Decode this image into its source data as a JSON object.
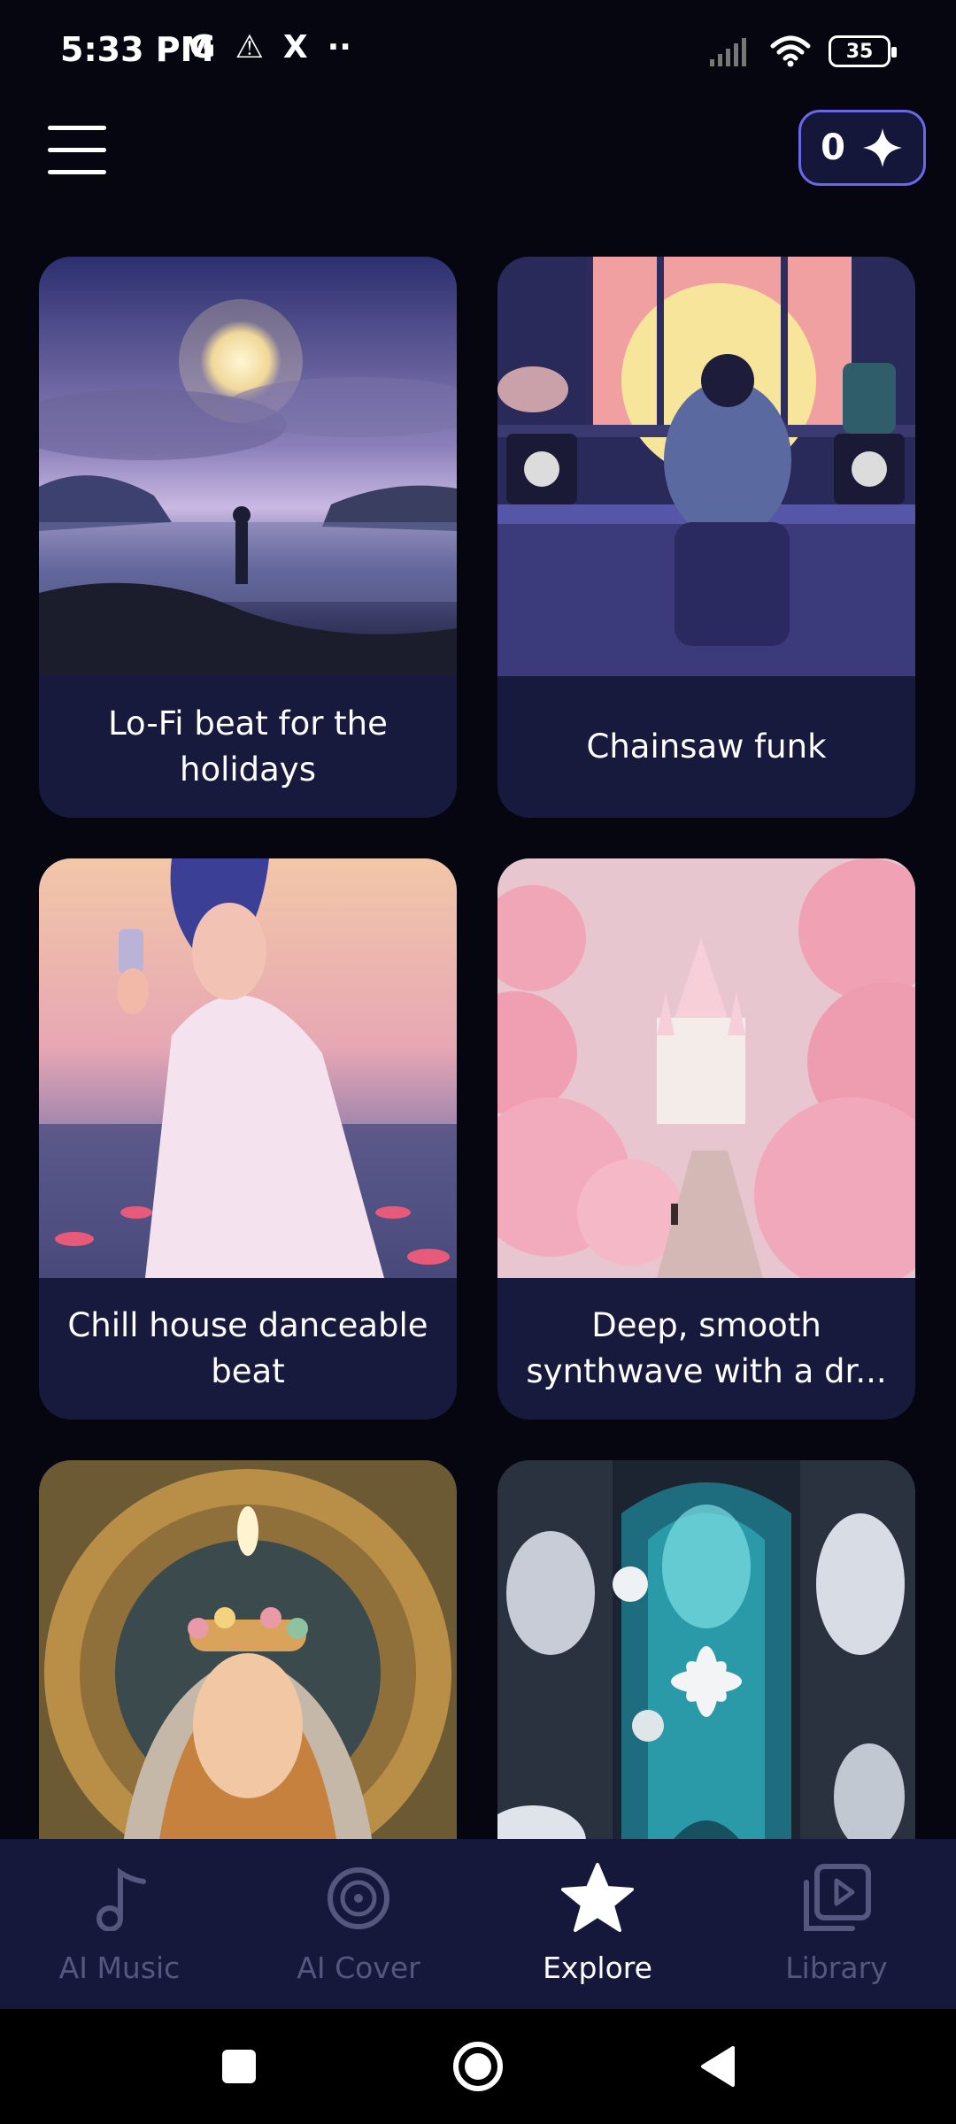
{
  "status_bar": {
    "time": "5:33 PM",
    "left_glyphs": [
      "G",
      "⚠",
      "X",
      "··"
    ],
    "battery": "35"
  },
  "header": {
    "menu_icon": "hamburger-menu-icon",
    "credits": "0",
    "credits_icon": "sparkle-icon"
  },
  "cards": [
    {
      "title": "Lo-Fi beat for the holidays",
      "art": "moonlit-lake"
    },
    {
      "title": "Chainsaw funk",
      "art": "lofi-studio"
    },
    {
      "title": "Chill house danceable beat",
      "art": "anime-girl-lotus"
    },
    {
      "title": "Deep, smooth synthwave with a dr...",
      "art": "pink-cloud-castle"
    },
    {
      "title": "",
      "art": "golden-halo-woman"
    },
    {
      "title": "",
      "art": "icy-flower-doorway"
    }
  ],
  "bottom_nav": {
    "items": [
      {
        "label": "AI Music",
        "icon": "music-note-icon"
      },
      {
        "label": "AI Cover",
        "icon": "vinyl-disc-icon"
      },
      {
        "label": "Explore",
        "icon": "star-icon"
      },
      {
        "label": "Library",
        "icon": "video-library-icon"
      }
    ],
    "active": "Explore"
  },
  "colors": {
    "background": "#05060f",
    "card": "#171a3d",
    "accent_border": "#6a68e8",
    "nav_inactive": "#54577e",
    "nav_active": "#ffffff"
  }
}
